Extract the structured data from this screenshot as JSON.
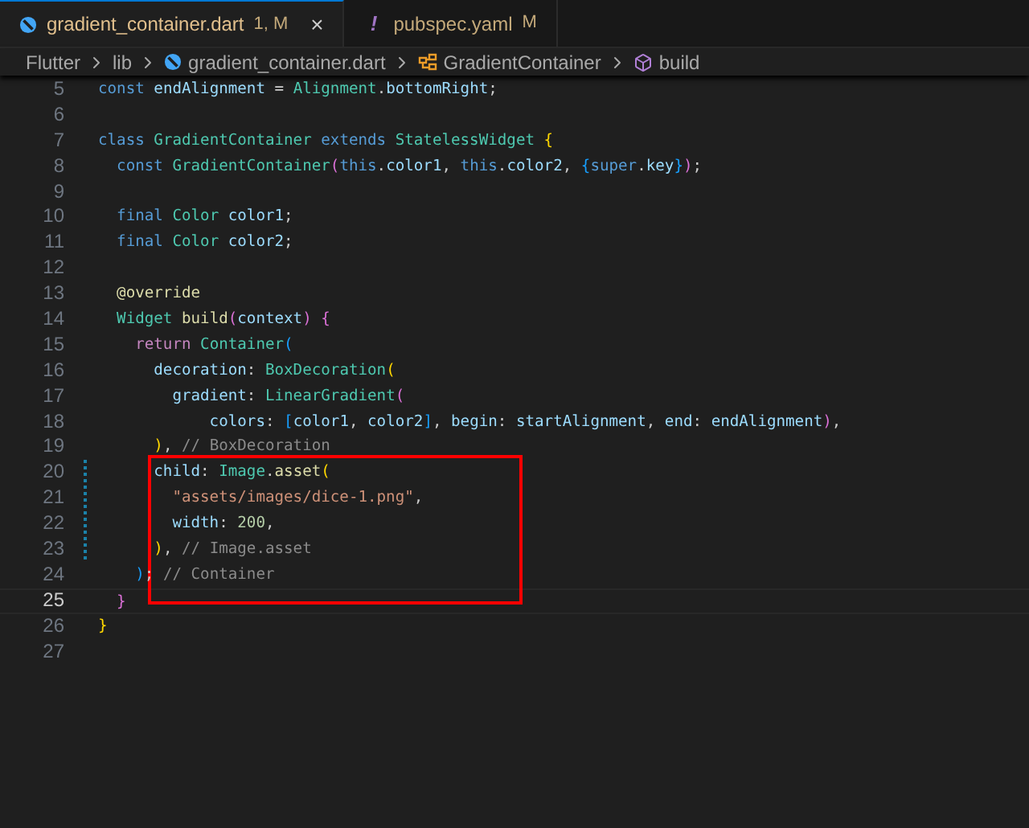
{
  "tabs": [
    {
      "kind": "dart",
      "label": "gradient_container.dart",
      "badge": "1, M",
      "close": "×",
      "selected": true
    },
    {
      "kind": "yaml",
      "icon_text": "!",
      "label": "pubspec.yaml",
      "badge": "M",
      "selected": false
    }
  ],
  "breadcrumbs": [
    {
      "kind": "folder",
      "label": "Flutter"
    },
    {
      "kind": "folder",
      "label": "lib"
    },
    {
      "kind": "dart",
      "label": "gradient_container.dart"
    },
    {
      "kind": "class",
      "label": "GradientContainer"
    },
    {
      "kind": "method",
      "label": "build"
    }
  ],
  "lines": [
    {
      "number": "5",
      "current": false,
      "modified": false,
      "tokens": [
        {
          "kind": "keyword",
          "text": "const"
        },
        {
          "kind": "prop",
          "text": " endAlignment "
        },
        {
          "kind": "punct",
          "text": "= "
        },
        {
          "kind": "type",
          "text": "Alignment"
        },
        {
          "kind": "punct",
          "text": "."
        },
        {
          "kind": "prop",
          "text": "bottomRight"
        },
        {
          "kind": "punct",
          "text": ";"
        }
      ]
    },
    {
      "number": "6",
      "current": false,
      "modified": false
    },
    {
      "number": "7",
      "current": false,
      "modified": false,
      "tokens": [
        {
          "kind": "keyword",
          "text": "class"
        },
        {
          "kind": "type",
          "text": " GradientContainer "
        },
        {
          "kind": "keyword",
          "text": "extends"
        },
        {
          "kind": "type",
          "text": " StatelessWidget "
        },
        {
          "kind": "bracket1",
          "text": "{"
        }
      ]
    },
    {
      "number": "8",
      "current": false,
      "modified": false,
      "tokens": [
        {
          "kind": "keyword",
          "text": "  const"
        },
        {
          "kind": "type",
          "text": " GradientContainer"
        },
        {
          "kind": "bracket2",
          "text": "("
        },
        {
          "kind": "keyword",
          "text": "this"
        },
        {
          "kind": "punct",
          "text": "."
        },
        {
          "kind": "prop",
          "text": "color1"
        },
        {
          "kind": "punct",
          "text": ", "
        },
        {
          "kind": "keyword",
          "text": "this"
        },
        {
          "kind": "punct",
          "text": "."
        },
        {
          "kind": "prop",
          "text": "color2"
        },
        {
          "kind": "punct",
          "text": ", "
        },
        {
          "kind": "bracket3",
          "text": "{"
        },
        {
          "kind": "keyword",
          "text": "super"
        },
        {
          "kind": "punct",
          "text": "."
        },
        {
          "kind": "prop",
          "text": "key"
        },
        {
          "kind": "bracket3",
          "text": "}"
        },
        {
          "kind": "bracket2",
          "text": ")"
        },
        {
          "kind": "punct",
          "text": ";"
        }
      ]
    },
    {
      "number": "9",
      "current": false,
      "modified": false
    },
    {
      "number": "10",
      "current": false,
      "modified": false,
      "tokens": [
        {
          "kind": "keyword",
          "text": "  final"
        },
        {
          "kind": "type",
          "text": " Color"
        },
        {
          "kind": "prop",
          "text": " color1"
        },
        {
          "kind": "punct",
          "text": ";"
        }
      ]
    },
    {
      "number": "11",
      "current": false,
      "modified": false,
      "tokens": [
        {
          "kind": "keyword",
          "text": "  final"
        },
        {
          "kind": "type",
          "text": " Color"
        },
        {
          "kind": "prop",
          "text": " color2"
        },
        {
          "kind": "punct",
          "text": ";"
        }
      ]
    },
    {
      "number": "12",
      "current": false,
      "modified": false
    },
    {
      "number": "13",
      "current": false,
      "modified": false,
      "tokens": [
        {
          "kind": "fn",
          "text": "  @override"
        }
      ]
    },
    {
      "number": "14",
      "current": false,
      "modified": false,
      "tokens": [
        {
          "kind": "type",
          "text": "  Widget"
        },
        {
          "kind": "fn",
          "text": " build"
        },
        {
          "kind": "bracket2",
          "text": "("
        },
        {
          "kind": "prop",
          "text": "context"
        },
        {
          "kind": "bracket2",
          "text": ")"
        },
        {
          "kind": "bracket2",
          "text": " {"
        }
      ]
    },
    {
      "number": "15",
      "current": false,
      "modified": false,
      "tokens": [
        {
          "kind": "control",
          "text": "    return"
        },
        {
          "kind": "type",
          "text": " Container"
        },
        {
          "kind": "bracket3",
          "text": "("
        }
      ]
    },
    {
      "number": "16",
      "current": false,
      "modified": false,
      "tokens": [
        {
          "kind": "prop",
          "text": "      decoration"
        },
        {
          "kind": "punct",
          "text": ": "
        },
        {
          "kind": "type",
          "text": "BoxDecoration"
        },
        {
          "kind": "bracket1",
          "text": "("
        }
      ]
    },
    {
      "number": "17",
      "current": false,
      "modified": false,
      "tokens": [
        {
          "kind": "prop",
          "text": "        gradient"
        },
        {
          "kind": "punct",
          "text": ": "
        },
        {
          "kind": "type",
          "text": "LinearGradient"
        },
        {
          "kind": "bracket2",
          "text": "("
        }
      ]
    },
    {
      "number": "18",
      "current": false,
      "modified": false,
      "tokens": [
        {
          "kind": "prop",
          "text": "            colors"
        },
        {
          "kind": "punct",
          "text": ": "
        },
        {
          "kind": "bracket3",
          "text": "["
        },
        {
          "kind": "prop",
          "text": "color1"
        },
        {
          "kind": "punct",
          "text": ", "
        },
        {
          "kind": "prop",
          "text": "color2"
        },
        {
          "kind": "bracket3",
          "text": "]"
        },
        {
          "kind": "punct",
          "text": ", "
        },
        {
          "kind": "prop",
          "text": "begin"
        },
        {
          "kind": "punct",
          "text": ": "
        },
        {
          "kind": "prop",
          "text": "startAlignment"
        },
        {
          "kind": "punct",
          "text": ", "
        },
        {
          "kind": "prop",
          "text": "end"
        },
        {
          "kind": "punct",
          "text": ": "
        },
        {
          "kind": "prop",
          "text": "endAlignment"
        },
        {
          "kind": "bracket2",
          "text": ")"
        },
        {
          "kind": "punct",
          "text": ","
        }
      ]
    },
    {
      "number": "19",
      "current": false,
      "modified": false,
      "tokens": [
        {
          "kind": "bracket1",
          "text": "      )"
        },
        {
          "kind": "punct",
          "text": ", "
        },
        {
          "kind": "comment",
          "text": "// BoxDecoration"
        }
      ]
    },
    {
      "number": "20",
      "current": false,
      "modified": true,
      "tokens": [
        {
          "kind": "prop",
          "text": "      child"
        },
        {
          "kind": "punct",
          "text": ": "
        },
        {
          "kind": "type",
          "text": "Image"
        },
        {
          "kind": "punct",
          "text": "."
        },
        {
          "kind": "fn",
          "text": "asset"
        },
        {
          "kind": "bracket1",
          "text": "("
        }
      ]
    },
    {
      "number": "21",
      "current": false,
      "modified": true,
      "tokens": [
        {
          "kind": "string",
          "text": "        \"assets/images/dice-1.png\""
        },
        {
          "kind": "punct",
          "text": ","
        }
      ]
    },
    {
      "number": "22",
      "current": false,
      "modified": true,
      "tokens": [
        {
          "kind": "prop",
          "text": "        width"
        },
        {
          "kind": "punct",
          "text": ": "
        },
        {
          "kind": "number",
          "text": "200"
        },
        {
          "kind": "punct",
          "text": ","
        }
      ]
    },
    {
      "number": "23",
      "current": false,
      "modified": true,
      "tokens": [
        {
          "kind": "bracket1",
          "text": "      )"
        },
        {
          "kind": "punct",
          "text": ", "
        },
        {
          "kind": "comment",
          "text": "// Image.asset"
        }
      ]
    },
    {
      "number": "24",
      "current": false,
      "modified": false,
      "tokens": [
        {
          "kind": "bracket3",
          "text": "    )"
        },
        {
          "kind": "punct",
          "text": "; "
        },
        {
          "kind": "comment",
          "text": "// Container"
        }
      ]
    },
    {
      "number": "25",
      "current": true,
      "modified": false,
      "tokens": [
        {
          "kind": "bracket2",
          "text": "  }"
        }
      ]
    },
    {
      "number": "26",
      "current": false,
      "modified": false,
      "tokens": [
        {
          "kind": "bracket1",
          "text": "}"
        }
      ]
    },
    {
      "number": "27",
      "current": false,
      "modified": false
    }
  ]
}
